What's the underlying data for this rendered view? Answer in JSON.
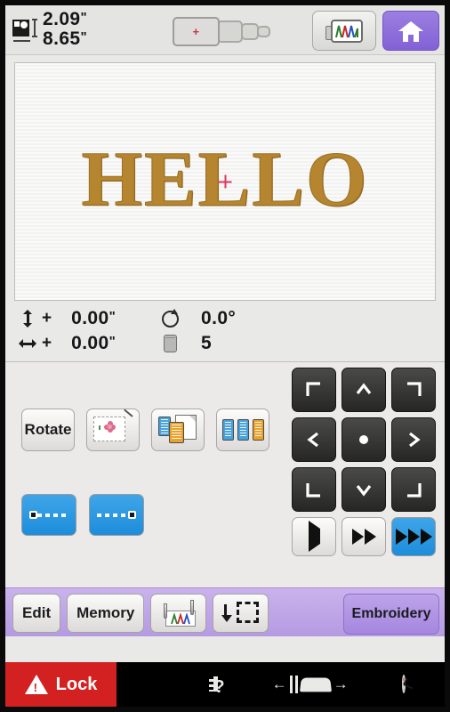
{
  "device": {
    "screen_title": "Embroidery Machine Touchscreen"
  },
  "topbar": {
    "size_icon": "design-size-icon",
    "height_value": "2.09",
    "width_value": "8.65",
    "unit": "\"",
    "hoop_selector": {
      "name": "hoop-size-selector",
      "selected_index": 0,
      "marker": "+",
      "options": [
        "Largest hoop",
        "Large hoop",
        "Medium hoop",
        "Small hoop"
      ]
    },
    "preview_button": {
      "name": "thread-preview-button",
      "icon": "thread-preview-icon"
    },
    "home_button": {
      "name": "home-button",
      "icon": "home-icon",
      "color": "#8361d6"
    }
  },
  "canvas": {
    "design_text": "HELLO",
    "thread_color": "#b5862f",
    "center_marker": "crosshair-marker",
    "center_marker_color": "#e0365e"
  },
  "stats": {
    "vertical_offset": {
      "icon": "vertical-offset-icon",
      "sign": "+",
      "value": "0.00",
      "unit": "\""
    },
    "horizontal_offset": {
      "icon": "horizontal-offset-icon",
      "sign": "+",
      "value": "0.00",
      "unit": "\""
    },
    "rotation": {
      "icon": "rotation-icon",
      "value": "0.0",
      "unit": "°"
    },
    "thread_count": {
      "icon": "thread-spool-icon",
      "value": "5"
    }
  },
  "controls": {
    "edit_buttons": [
      {
        "name": "rotate-button",
        "label": "Rotate",
        "icon": null
      },
      {
        "name": "applique-edit-button",
        "label": "",
        "icon": "applique-flower-icon"
      },
      {
        "name": "duplicate-layer-button",
        "label": "",
        "icon": "copy-layers-icon"
      },
      {
        "name": "color-layers-button",
        "label": "",
        "icon": "three-spools-icon"
      }
    ],
    "stitch_buttons": [
      {
        "name": "stitch-back-button",
        "icon": "stitch-start-icon"
      },
      {
        "name": "stitch-forward-button",
        "icon": "stitch-end-icon"
      }
    ],
    "dpad": [
      {
        "name": "move-top-left-button",
        "icon": "corner-top-left-icon"
      },
      {
        "name": "move-up-button",
        "icon": "arrow-up-icon"
      },
      {
        "name": "move-top-right-button",
        "icon": "corner-top-right-icon"
      },
      {
        "name": "move-left-button",
        "icon": "arrow-left-icon"
      },
      {
        "name": "move-center-button",
        "icon": "center-dot-icon"
      },
      {
        "name": "move-right-button",
        "icon": "arrow-right-icon"
      },
      {
        "name": "move-bottom-left-button",
        "icon": "corner-bottom-left-icon"
      },
      {
        "name": "move-down-button",
        "icon": "arrow-down-icon"
      },
      {
        "name": "move-bottom-right-button",
        "icon": "corner-bottom-right-icon"
      }
    ],
    "speed_buttons": [
      {
        "name": "speed-slow-button",
        "icon": "play-icon",
        "selected": false
      },
      {
        "name": "speed-medium-button",
        "icon": "fast-forward-icon",
        "selected": false
      },
      {
        "name": "speed-fast-button",
        "icon": "triple-forward-icon",
        "selected": true
      }
    ],
    "selected_speed": "fast",
    "selected_speed_color": "#1d8ddb"
  },
  "bottombar": {
    "background_color": "#b59ae2",
    "buttons": [
      {
        "name": "edit-button",
        "label": "Edit"
      },
      {
        "name": "memory-button",
        "label": "Memory"
      },
      {
        "name": "needle-thread-button",
        "label": "",
        "icon": "needle-thread-icon"
      },
      {
        "name": "trace-frame-button",
        "label": "",
        "icon": "return-to-origin-icon"
      }
    ],
    "mode_button": {
      "name": "embroidery-mode-button",
      "label": "Embroidery"
    }
  },
  "statusbar": {
    "lock": {
      "name": "lock-button",
      "label": "Lock",
      "icon": "warning-triangle-icon",
      "color": "#d32121"
    },
    "icons": [
      {
        "name": "document-button",
        "icon": "document-icon"
      },
      {
        "name": "help-guide-button",
        "icon": "film-question-icon"
      },
      {
        "name": "presser-foot-button",
        "icon": "presser-foot-icon"
      },
      {
        "name": "clock-button",
        "icon": "clock-icon"
      }
    ]
  }
}
